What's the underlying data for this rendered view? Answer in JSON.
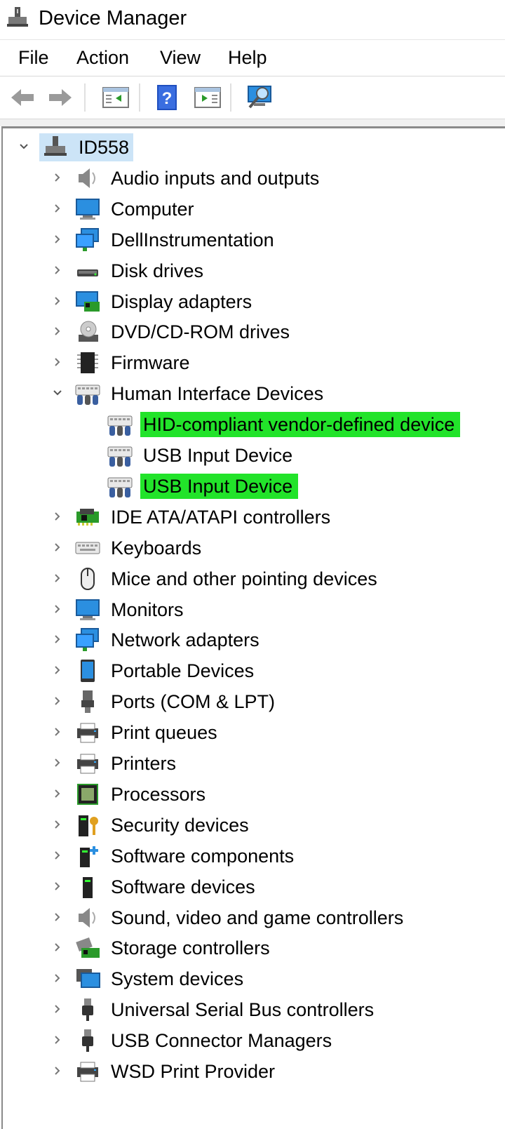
{
  "window": {
    "title": "Device Manager",
    "icon": "device-manager-icon"
  },
  "menu": [
    "File",
    "Action",
    "View",
    "Help"
  ],
  "toolbar": {
    "buttons": [
      "back-icon",
      "forward-icon",
      "show-hide-console-tree-icon",
      "help-icon",
      "properties-pane-icon",
      "scan-hardware-icon"
    ]
  },
  "colors": {
    "highlight": "#22e32a",
    "selection": "#cce4f7",
    "monitor_blue": "#1e90ff"
  },
  "tree": {
    "root": {
      "label": "ID558",
      "expanded": true,
      "icon": "computer-network-icon"
    },
    "categories": [
      {
        "label": "Audio inputs and outputs",
        "icon": "speaker-icon"
      },
      {
        "label": "Computer",
        "icon": "monitor-icon"
      },
      {
        "label": "DellInstrumentation",
        "icon": "network-monitor-icon"
      },
      {
        "label": "Disk drives",
        "icon": "disk-drive-icon"
      },
      {
        "label": "Display adapters",
        "icon": "display-adapter-icon"
      },
      {
        "label": "DVD/CD-ROM drives",
        "icon": "dvd-icon"
      },
      {
        "label": "Firmware",
        "icon": "chip-icon"
      },
      {
        "label": "Human Interface Devices",
        "icon": "hid-icon",
        "expanded": true,
        "children": [
          {
            "label": "HID-compliant vendor-defined device",
            "icon": "hid-icon",
            "highlighted": true
          },
          {
            "label": "USB Input Device",
            "icon": "hid-icon",
            "highlighted": false
          },
          {
            "label": "USB Input Device",
            "icon": "hid-icon",
            "highlighted": true
          }
        ]
      },
      {
        "label": "IDE ATA/ATAPI controllers",
        "icon": "controller-card-icon"
      },
      {
        "label": "Keyboards",
        "icon": "keyboard-icon"
      },
      {
        "label": "Mice and other pointing devices",
        "icon": "mouse-icon"
      },
      {
        "label": "Monitors",
        "icon": "monitor-icon"
      },
      {
        "label": "Network adapters",
        "icon": "network-monitor-icon"
      },
      {
        "label": "Portable Devices",
        "icon": "portable-device-icon"
      },
      {
        "label": "Ports (COM & LPT)",
        "icon": "port-icon"
      },
      {
        "label": "Print queues",
        "icon": "printer-icon"
      },
      {
        "label": "Printers",
        "icon": "printer-icon"
      },
      {
        "label": "Processors",
        "icon": "processor-icon"
      },
      {
        "label": "Security devices",
        "icon": "security-key-icon"
      },
      {
        "label": "Software components",
        "icon": "software-component-icon"
      },
      {
        "label": "Software devices",
        "icon": "software-device-icon"
      },
      {
        "label": "Sound, video and game controllers",
        "icon": "speaker-icon"
      },
      {
        "label": "Storage controllers",
        "icon": "storage-controller-icon"
      },
      {
        "label": "System devices",
        "icon": "system-devices-icon"
      },
      {
        "label": "Universal Serial Bus controllers",
        "icon": "usb-plug-icon"
      },
      {
        "label": "USB Connector Managers",
        "icon": "usb-plug-icon"
      },
      {
        "label": "WSD Print Provider",
        "icon": "printer-icon"
      }
    ]
  }
}
